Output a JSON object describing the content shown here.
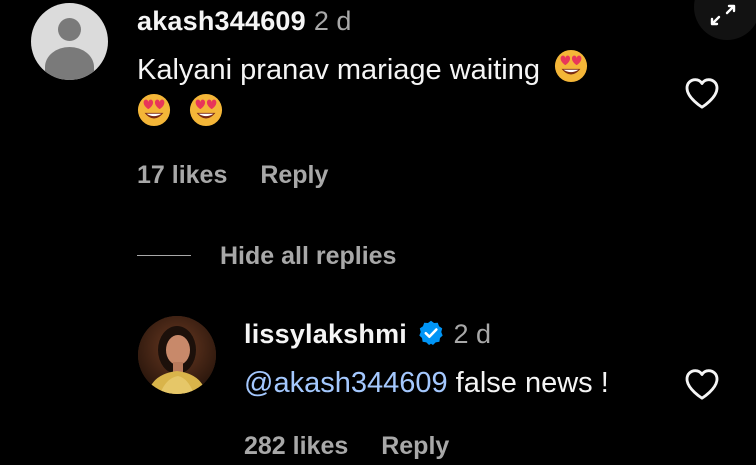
{
  "comment": {
    "username": "akash344609",
    "time": "2 d",
    "text_line1": "Kalyani pranav mariage waiting",
    "likes": "17 likes",
    "reply": "Reply"
  },
  "replies_toggle": "Hide all replies",
  "reply_comment": {
    "username": "lissylakshmi",
    "time": "2 d",
    "mention": "@akash344609",
    "text": "false news !",
    "likes": "282 likes",
    "reply": "Reply"
  },
  "icons": {
    "emoji": "smiling-face-with-heart-eyes-icon",
    "like": "heart-outline-icon",
    "verified": "verified-badge-icon",
    "expand": "expand-icon"
  },
  "colors": {
    "background": "#000000",
    "text": "#f5f5f5",
    "secondary": "#a8a8a8",
    "mention": "#a4c8fe",
    "verified": "#0095f6"
  }
}
